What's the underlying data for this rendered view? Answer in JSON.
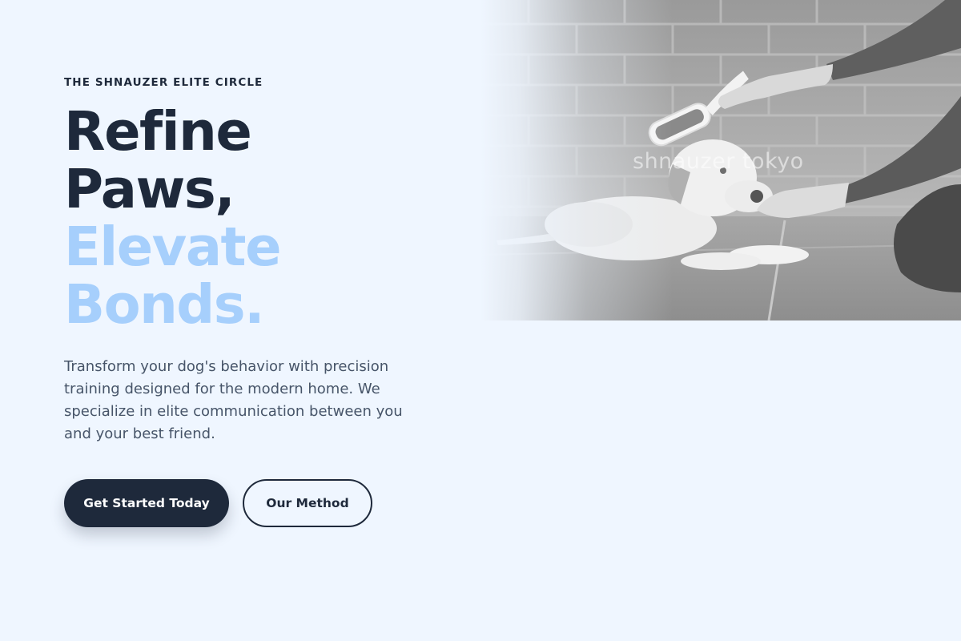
{
  "hero": {
    "eyebrow": "THE SHNAUZER ELITE CIRCLE",
    "headline_line_1": "Refine",
    "headline_line_2": "Paws,",
    "headline_line_3": "Elevate",
    "headline_line_4": "Bonds.",
    "description": "Transform your dog's behavior with precision training designed for the modern home. We specialize in elite communication between you and your best friend.",
    "primary_button_label": "Get Started Today",
    "secondary_button_label": "Our Method",
    "image_watermark": "shnauzer tokyo"
  },
  "colors": {
    "background": "#eff6ff",
    "dark_text": "#1e293b",
    "accent_light_blue": "#a6cffc",
    "body_text": "#475569"
  }
}
